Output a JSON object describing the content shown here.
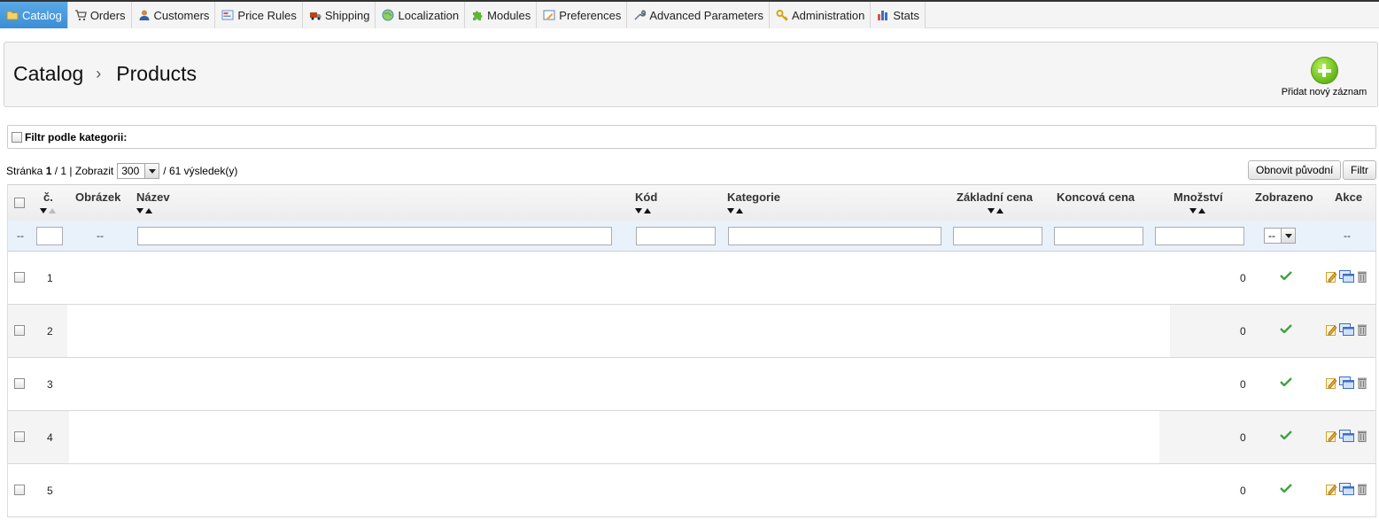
{
  "nav": {
    "tabs": [
      {
        "label": "Catalog",
        "icon": "folder-icon",
        "active": true
      },
      {
        "label": "Orders",
        "icon": "cart-icon"
      },
      {
        "label": "Customers",
        "icon": "user-icon"
      },
      {
        "label": "Price Rules",
        "icon": "price-tag-icon"
      },
      {
        "label": "Shipping",
        "icon": "truck-icon"
      },
      {
        "label": "Localization",
        "icon": "globe-icon"
      },
      {
        "label": "Modules",
        "icon": "puzzle-icon"
      },
      {
        "label": "Preferences",
        "icon": "preferences-icon"
      },
      {
        "label": "Advanced Parameters",
        "icon": "wrench-icon"
      },
      {
        "label": "Administration",
        "icon": "key-icon"
      },
      {
        "label": "Stats",
        "icon": "bar-chart-icon"
      }
    ]
  },
  "header": {
    "breadcrumb_root": "Catalog",
    "breadcrumb_sep": "›",
    "breadcrumb_page": "Products",
    "add_new_label": "Přidat nový záznam"
  },
  "category_filter": {
    "label": "Filtr podle kategorii:"
  },
  "pagination": {
    "page_label": "Stránka",
    "current_page": "1",
    "total_pages": "1",
    "show_label": "Zobrazit",
    "per_page": "300",
    "results": "/ 61 výsledek(y)"
  },
  "buttons": {
    "reset": "Obnovit původní",
    "filter": "Filtr"
  },
  "table": {
    "headers": {
      "id": "č.",
      "image": "Obrázek",
      "name": "Název",
      "reference": "Kód",
      "category": "Kategorie",
      "base_price": "Základní cena",
      "final_price": "Koncová cena",
      "quantity": "Množství",
      "displayed": "Zobrazeno",
      "actions": "Akce"
    },
    "filter_row": {
      "dash": "--",
      "displayed_select": "--"
    },
    "rows": [
      {
        "id": "1",
        "quantity": "0",
        "displayed": true
      },
      {
        "id": "2",
        "quantity": "0",
        "displayed": true
      },
      {
        "id": "3",
        "quantity": "0",
        "displayed": true
      },
      {
        "id": "4",
        "quantity": "0",
        "displayed": true
      },
      {
        "id": "5",
        "quantity": "0",
        "displayed": true
      }
    ]
  },
  "colors": {
    "active_tab": "#4a9ee0",
    "check_green": "#3fa33f",
    "accent_add": "#66b91b"
  }
}
